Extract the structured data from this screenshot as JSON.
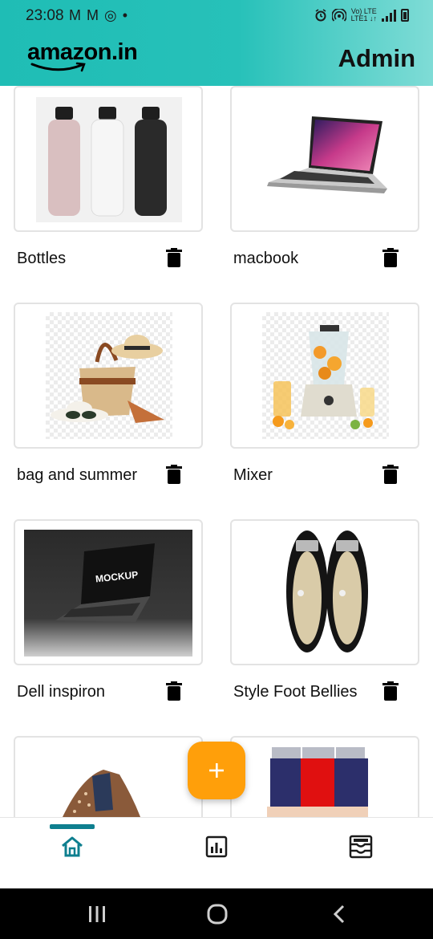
{
  "status_bar": {
    "time": "23:08",
    "notification_icons": "M M ◎ •",
    "network_top": "Vo) LTE",
    "network_bottom": "LTE1 ↓↑"
  },
  "header": {
    "logo_text": "amazon.in",
    "admin_label": "Admin",
    "gradient_start": "#1fbdb5",
    "gradient_end": "#7fdcd6"
  },
  "products": [
    {
      "name": "Bottles",
      "image": "bottles-image"
    },
    {
      "name": "macbook",
      "image": "laptop-image"
    },
    {
      "name": "bag and summer",
      "image": "summer-bag-image"
    },
    {
      "name": "Mixer",
      "image": "mixer-image"
    },
    {
      "name": "Dell inspiron",
      "image": "mockup-laptop-image"
    },
    {
      "name": "Style Foot Bellies",
      "image": "bellies-shoes-image"
    },
    {
      "name": "",
      "image": "shoe-image"
    },
    {
      "name": "",
      "image": "shorts-image"
    }
  ],
  "mockup_text": "MOCKUP",
  "fab": {
    "icon": "plus-icon",
    "color": "#ff9f0a"
  },
  "bottom_nav": {
    "items": [
      {
        "icon": "home-icon",
        "active": true
      },
      {
        "icon": "bar-chart-icon",
        "active": false
      },
      {
        "icon": "orders-tray-icon",
        "active": false
      }
    ],
    "accent": "#0e7f8f"
  },
  "system_nav": [
    "recent-apps-icon",
    "home-circle-icon",
    "back-icon"
  ]
}
